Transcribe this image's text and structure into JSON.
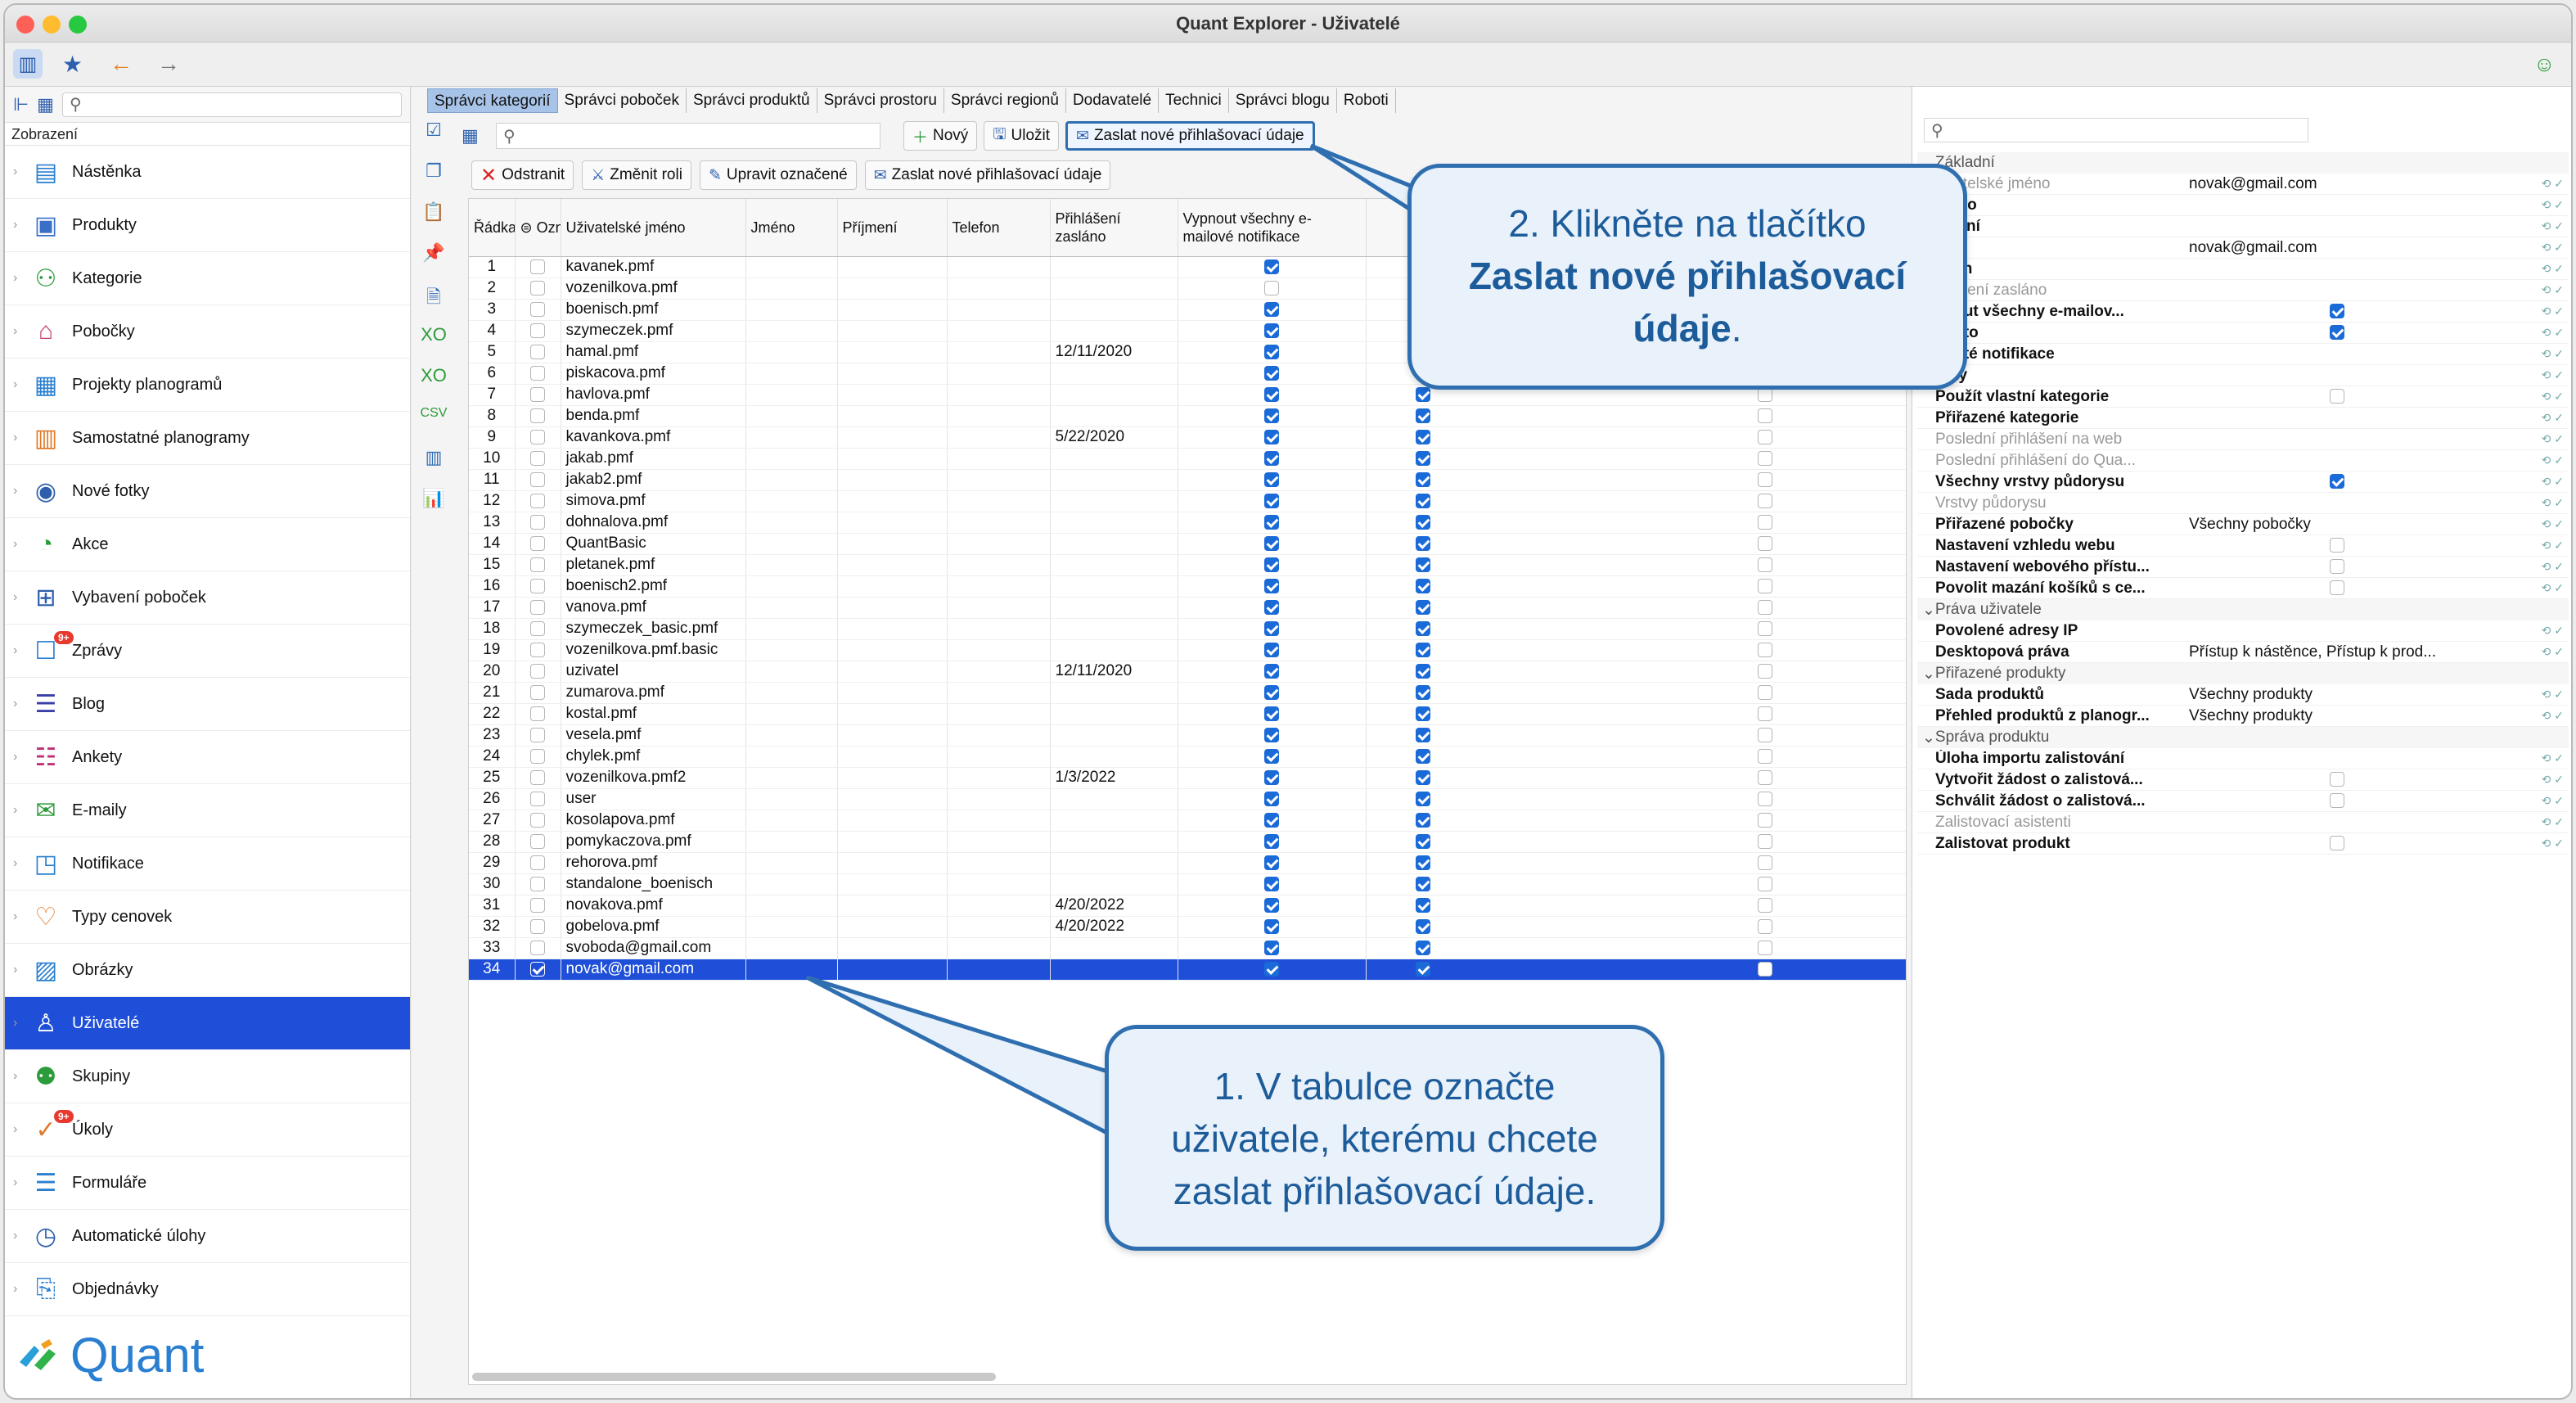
{
  "window": {
    "title": "Quant Explorer - Uživatelé"
  },
  "sidebar": {
    "section": "Zobrazení",
    "brand": "Quant",
    "items": [
      {
        "label": "Nástěnka",
        "icon": "dashboard-icon"
      },
      {
        "label": "Produkty",
        "icon": "product-icon"
      },
      {
        "label": "Kategorie",
        "icon": "category-icon"
      },
      {
        "label": "Pobočky",
        "icon": "store-icon"
      },
      {
        "label": "Projekty planogramů",
        "icon": "planogram-project-icon"
      },
      {
        "label": "Samostatné planogramy",
        "icon": "planogram-icon"
      },
      {
        "label": "Nové fotky",
        "icon": "camera-icon"
      },
      {
        "label": "Akce",
        "icon": "promo-icon"
      },
      {
        "label": "Vybavení poboček",
        "icon": "equipment-icon"
      },
      {
        "label": "Zprávy",
        "icon": "messages-icon",
        "badge": "9+"
      },
      {
        "label": "Blog",
        "icon": "blog-icon"
      },
      {
        "label": "Ankety",
        "icon": "survey-icon"
      },
      {
        "label": "E-maily",
        "icon": "email-icon"
      },
      {
        "label": "Notifikace",
        "icon": "notification-icon"
      },
      {
        "label": "Typy cenovek",
        "icon": "price-tag-icon"
      },
      {
        "label": "Obrázky",
        "icon": "image-icon"
      },
      {
        "label": "Uživatelé",
        "icon": "user-icon"
      },
      {
        "label": "Skupiny",
        "icon": "group-icon"
      },
      {
        "label": "Úkoly",
        "icon": "task-icon",
        "badge": "9+"
      },
      {
        "label": "Formuláře",
        "icon": "form-icon"
      },
      {
        "label": "Automatické úlohy",
        "icon": "automation-icon"
      },
      {
        "label": "Objednávky",
        "icon": "order-icon"
      }
    ]
  },
  "tabs": [
    "Správci kategorií",
    "Správci poboček",
    "Správci produktů",
    "Správci prostoru",
    "Správci regionů",
    "Dodavatelé",
    "Technici",
    "Správci blogu",
    "Roboti"
  ],
  "toolbar": {
    "new": "Nový",
    "save": "Uložit",
    "send": "Zaslat nové přihlašovací údaje",
    "delete": "Odstranit",
    "change_role": "Změnit roli",
    "edit_marked": "Upravit označené",
    "send2": "Zaslat nové přihlašovací údaje"
  },
  "table": {
    "headers": [
      "Řádka",
      "Označené",
      "Uživatelské jméno",
      "Jméno",
      "Příjmení",
      "Telefon",
      "Přihlášení zasláno",
      "Vypnout všechny e-mailové notifikace"
    ],
    "rows": [
      {
        "n": "1",
        "user": "kavanek.pmf",
        "sent": ""
      },
      {
        "n": "2",
        "user": "vozenilkova.pmf",
        "sent": ""
      },
      {
        "n": "3",
        "user": "boenisch.pmf",
        "sent": ""
      },
      {
        "n": "4",
        "user": "szymeczek.pmf",
        "sent": ""
      },
      {
        "n": "5",
        "user": "hamal.pmf",
        "sent": "12/11/2020"
      },
      {
        "n": "6",
        "user": "piskacova.pmf",
        "sent": ""
      },
      {
        "n": "7",
        "user": "havlova.pmf",
        "sent": ""
      },
      {
        "n": "8",
        "user": "benda.pmf",
        "sent": ""
      },
      {
        "n": "9",
        "user": "kavankova.pmf",
        "sent": "5/22/2020"
      },
      {
        "n": "10",
        "user": "jakab.pmf",
        "sent": ""
      },
      {
        "n": "11",
        "user": "jakab2.pmf",
        "sent": ""
      },
      {
        "n": "12",
        "user": "simova.pmf",
        "sent": ""
      },
      {
        "n": "13",
        "user": "dohnalova.pmf",
        "sent": ""
      },
      {
        "n": "14",
        "user": "QuantBasic",
        "sent": ""
      },
      {
        "n": "15",
        "user": "pletanek.pmf",
        "sent": ""
      },
      {
        "n": "16",
        "user": "boenisch2.pmf",
        "sent": ""
      },
      {
        "n": "17",
        "user": "vanova.pmf",
        "sent": ""
      },
      {
        "n": "18",
        "user": "szymeczek_basic.pmf",
        "sent": ""
      },
      {
        "n": "19",
        "user": "vozenilkova.pmf.basic",
        "sent": ""
      },
      {
        "n": "20",
        "user": "uzivatel",
        "sent": "12/11/2020"
      },
      {
        "n": "21",
        "user": "zumarova.pmf",
        "sent": ""
      },
      {
        "n": "22",
        "user": "kostal.pmf",
        "sent": ""
      },
      {
        "n": "23",
        "user": "vesela.pmf",
        "sent": ""
      },
      {
        "n": "24",
        "user": "chylek.pmf",
        "sent": ""
      },
      {
        "n": "25",
        "user": "vozenilkova.pmf2",
        "sent": "1/3/2022"
      },
      {
        "n": "26",
        "user": "user",
        "sent": ""
      },
      {
        "n": "27",
        "user": "kosolapova.pmf",
        "sent": ""
      },
      {
        "n": "28",
        "user": "pomykaczova.pmf",
        "sent": ""
      },
      {
        "n": "29",
        "user": "rehorova.pmf",
        "sent": ""
      },
      {
        "n": "30",
        "user": "standalone_boenisch",
        "sent": ""
      },
      {
        "n": "31",
        "user": "novakova.pmf",
        "sent": "4/20/2022"
      },
      {
        "n": "32",
        "user": "gobelova.pmf",
        "sent": "4/20/2022"
      },
      {
        "n": "33",
        "user": "svoboda@gmail.com",
        "sent": ""
      },
      {
        "n": "34",
        "user": "novak@gmail.com",
        "sent": ""
      }
    ]
  },
  "properties": {
    "groups": [
      {
        "title": "Základní",
        "rows": [
          {
            "name": "živatelské jméno",
            "value": "novak@gmail.com",
            "dim": true
          },
          {
            "name": "méno",
            "value": ""
          },
          {
            "name": "íjmení",
            "value": ""
          },
          {
            "name": "mail",
            "value": "novak@gmail.com"
          },
          {
            "name": "lefon",
            "value": ""
          },
          {
            "name": "ihlášení zasláno",
            "value": "",
            "dim": true
          },
          {
            "name": "pnout všechny e-mailov...",
            "value": "",
            "check": "on"
          },
          {
            "name": "pnuto",
            "value": "",
            "check": "on"
          },
          {
            "name": "pnuté notifikace",
            "value": ""
          },
          {
            "name": "títky",
            "value": ""
          },
          {
            "name": "Použít vlastní kategorie",
            "value": "",
            "check": "off"
          },
          {
            "name": "Přiřazené kategorie",
            "value": ""
          },
          {
            "name": "Poslední přihlášení na web",
            "value": "",
            "dim": true
          },
          {
            "name": "Poslední přihlášení do Qua...",
            "value": "",
            "dim": true
          },
          {
            "name": "Všechny vrstvy půdorysu",
            "value": "",
            "check": "on"
          },
          {
            "name": "Vrstvy půdorysu",
            "value": "",
            "dim": true
          },
          {
            "name": "Přiřazené pobočky",
            "value": "Všechny pobočky"
          },
          {
            "name": "Nastavení vzhledu webu",
            "value": "",
            "check": "off"
          },
          {
            "name": "Nastavení webového přístu...",
            "value": "",
            "check": "off"
          },
          {
            "name": "Povolit mazání košíků s ce...",
            "value": "",
            "check": "off"
          }
        ]
      },
      {
        "title": "Práva uživatele",
        "rows": [
          {
            "name": "Povolené adresy IP",
            "value": ""
          },
          {
            "name": "Desktopová práva",
            "value": "Přístup k nástěnce, Přístup k prod..."
          }
        ]
      },
      {
        "title": "Přiřazené produkty",
        "rows": [
          {
            "name": "Sada produktů",
            "value": "Všechny produkty"
          },
          {
            "name": "Přehled produktů z planogr...",
            "value": "Všechny produkty"
          }
        ]
      },
      {
        "title": "Správa produktu",
        "rows": [
          {
            "name": "Úloha importu zalistování",
            "value": ""
          },
          {
            "name": "Vytvořit žádost o zalistová...",
            "value": "",
            "check": "off"
          },
          {
            "name": "Schválit žádost o zalistová...",
            "value": "",
            "check": "off"
          },
          {
            "name": "Zalistovací asistenti",
            "value": "",
            "dim": true
          },
          {
            "name": "Zalistovat produkt",
            "value": "",
            "check": "off"
          }
        ]
      }
    ]
  },
  "callouts": {
    "step2_line1": "2. Klikněte na tlačítko",
    "step2_bold": "Zaslat nové přihlašovací údaje",
    "step2_end": ".",
    "step1": "1. V tabulce označte uživatele, kterému chcete zaslat přihlašovací údaje."
  },
  "colors": {
    "accent": "#1f4fd8",
    "callout_border": "#2f6fb0",
    "callout_bg": "#e9f1fa",
    "check": "#1a6bd8"
  }
}
